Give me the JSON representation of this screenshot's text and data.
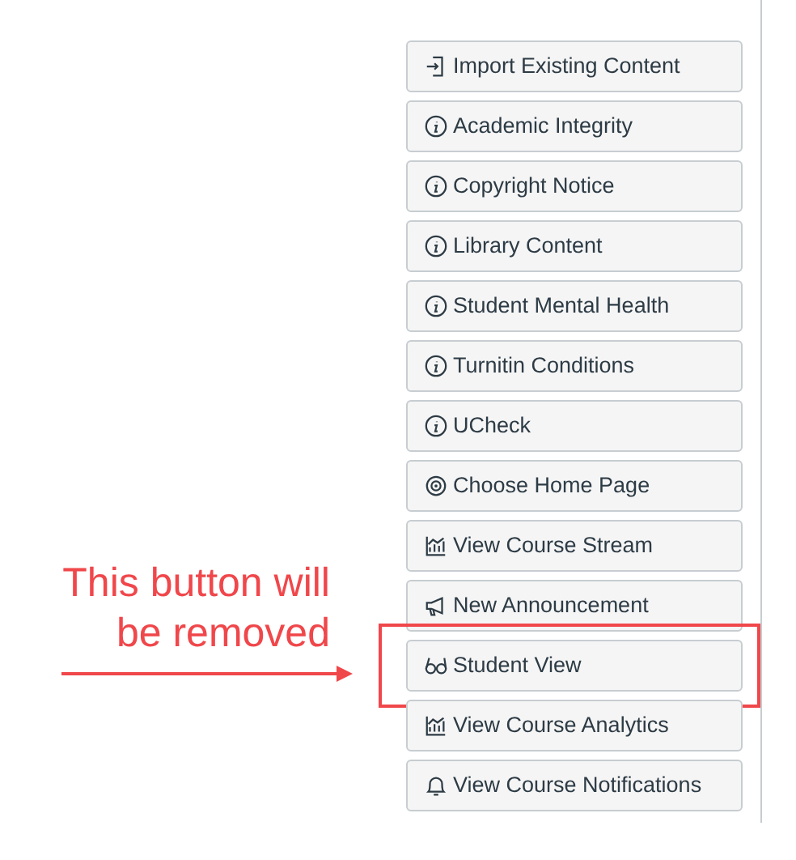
{
  "buttons": [
    {
      "label": "Import Existing Content",
      "kind": "import",
      "highlighted": false
    },
    {
      "label": "Academic Integrity",
      "kind": "info",
      "highlighted": false
    },
    {
      "label": "Copyright Notice",
      "kind": "info",
      "highlighted": false
    },
    {
      "label": "Library Content",
      "kind": "info",
      "highlighted": false
    },
    {
      "label": "Student Mental Health",
      "kind": "info",
      "highlighted": false
    },
    {
      "label": "Turnitin Conditions",
      "kind": "info",
      "highlighted": false
    },
    {
      "label": "UCheck",
      "kind": "info",
      "highlighted": false
    },
    {
      "label": "Choose Home Page",
      "kind": "target",
      "highlighted": false
    },
    {
      "label": "View Course Stream",
      "kind": "chart",
      "highlighted": false
    },
    {
      "label": "New Announcement",
      "kind": "megaphone",
      "highlighted": false
    },
    {
      "label": "Student View",
      "kind": "glasses",
      "highlighted": true
    },
    {
      "label": "View Course Analytics",
      "kind": "chart",
      "highlighted": false
    },
    {
      "label": "View Course Notifications",
      "kind": "bell",
      "highlighted": false
    }
  ],
  "callout": {
    "lines": [
      "This button will",
      "be removed"
    ]
  }
}
